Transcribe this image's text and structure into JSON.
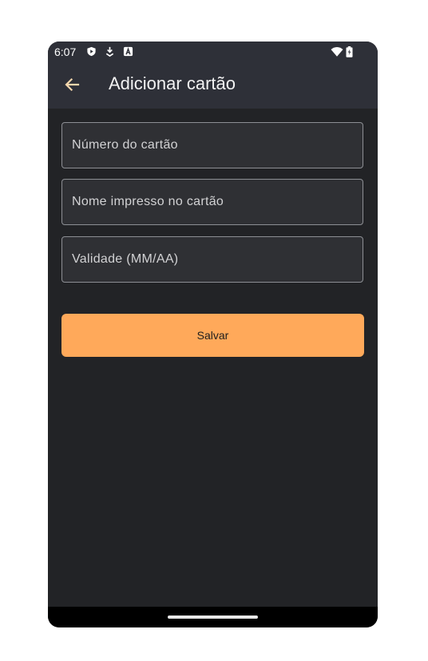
{
  "status_bar": {
    "time": "6:07",
    "icons": [
      "play-protect-icon",
      "download-icon",
      "a-badge-icon",
      "wifi-icon",
      "battery-icon"
    ]
  },
  "app_bar": {
    "back_icon": "arrow-back-icon",
    "title": "Adicionar cartão"
  },
  "form": {
    "card_number": {
      "value": "",
      "placeholder": "Número do cartão"
    },
    "cardholder_name": {
      "value": "",
      "placeholder": "Nome impresso no cartão"
    },
    "expiry": {
      "value": "",
      "placeholder": "Validade (MM/AA)"
    },
    "save_label": "Salvar"
  },
  "colors": {
    "background": "#222326",
    "app_bar": "#2e3038",
    "field_background": "#2f3034",
    "field_border": "#8d8f94",
    "accent": "#ffa95a",
    "back_arrow": "#f5d7ad"
  }
}
